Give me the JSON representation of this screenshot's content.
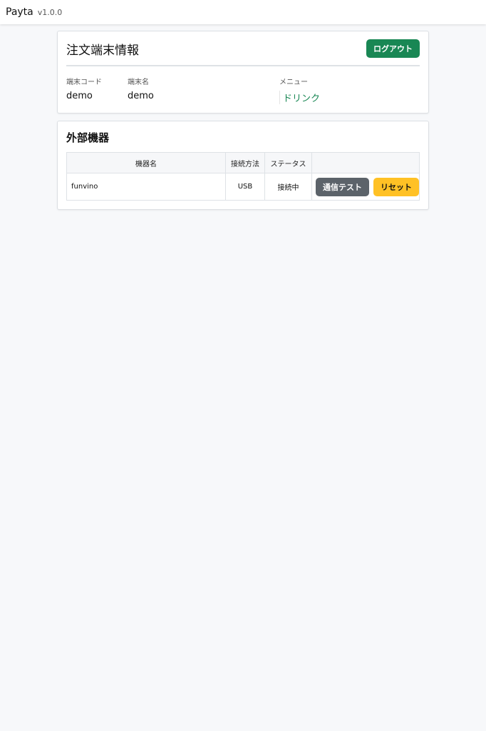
{
  "navbar": {
    "brand": "Payta",
    "version": "v1.0.0"
  },
  "terminal": {
    "title": "注文端末情報",
    "logout_label": "ログアウト",
    "fields": {
      "code_label": "端末コード",
      "code_value": "demo",
      "name_label": "端末名",
      "name_value": "demo",
      "menu_label": "メニュー",
      "menu_value": "ドリンク"
    }
  },
  "devices": {
    "title": "外部機器",
    "columns": [
      "機器名",
      "接続方法",
      "ステータス",
      ""
    ],
    "rows": [
      {
        "name": "funvino",
        "connection": "USB",
        "status": "接続中",
        "test_label": "通信テスト",
        "reset_label": "リセット"
      }
    ]
  },
  "colors": {
    "success": "#198754",
    "secondary": "#5c636a",
    "warning": "#ffc125"
  }
}
